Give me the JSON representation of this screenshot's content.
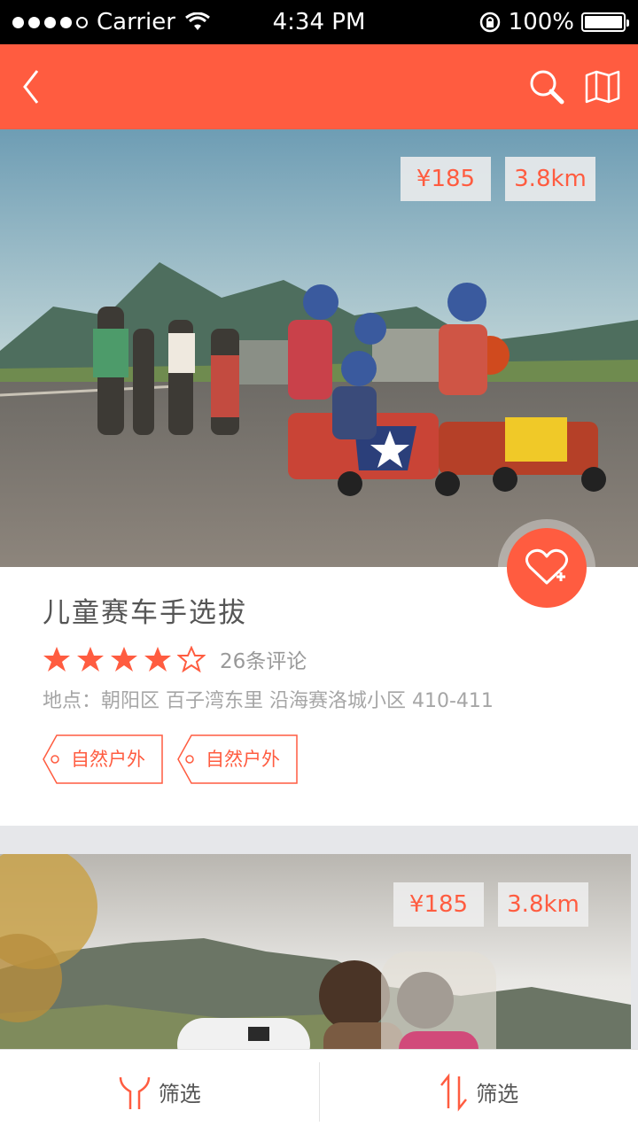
{
  "status_bar": {
    "carrier": "Carrier",
    "time": "4:34 PM",
    "battery": "100%"
  },
  "nav": {
    "back_icon": "chevron-left-icon",
    "search_icon": "search-icon",
    "map_icon": "map-icon"
  },
  "listings": [
    {
      "price": "¥185",
      "distance": "3.8km",
      "title": "儿童赛车手选拔",
      "rating": 4,
      "max_rating": 5,
      "reviews": "26条评论",
      "address": "地点：朝阳区 百子湾东里 沿海赛洛城小区 410-411",
      "tags": [
        "自然户外",
        "自然户外"
      ],
      "favorite_icon": "heart-plus-icon"
    },
    {
      "price": "¥185",
      "distance": "3.8km"
    }
  ],
  "bottom_bar": {
    "filter_label": "筛选",
    "sort_label": "筛选",
    "filter_icon": "filter-icon",
    "sort_icon": "sort-icon"
  },
  "colors": {
    "accent": "#ff5c40",
    "background": "#e6e7ea"
  }
}
